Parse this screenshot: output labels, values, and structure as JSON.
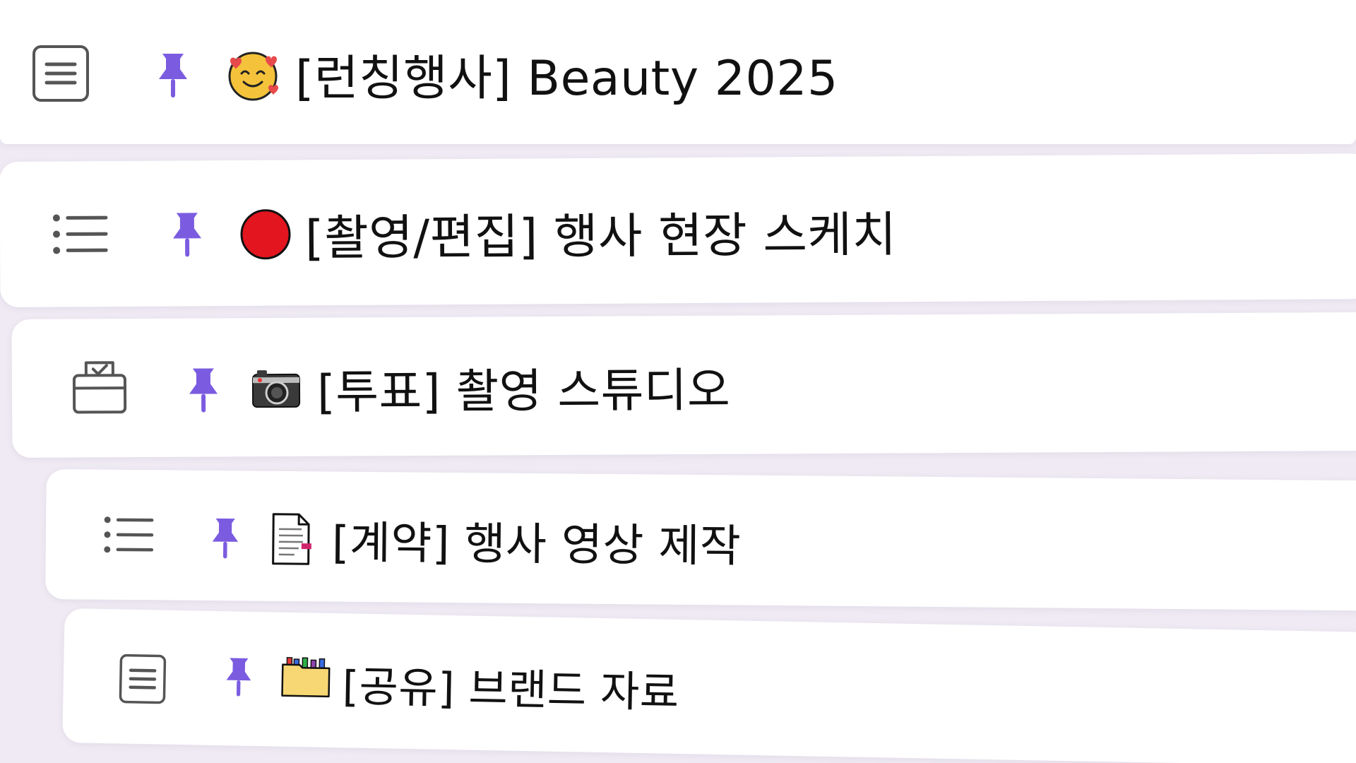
{
  "items": [
    {
      "type_icon": "document-lines-icon",
      "pin_icon": "pushpin-icon",
      "emoji": "smiling-face-with-hearts-icon",
      "title": "[런칭행사] Beauty 2025"
    },
    {
      "type_icon": "bulleted-list-icon",
      "pin_icon": "pushpin-icon",
      "emoji": "red-circle-icon",
      "title": "[촬영/편집] 행사 현장 스케치"
    },
    {
      "type_icon": "ballot-box-icon",
      "pin_icon": "pushpin-icon",
      "emoji": "camera-icon",
      "title": "[투표] 촬영 스튜디오"
    },
    {
      "type_icon": "bulleted-list-icon",
      "pin_icon": "pushpin-icon",
      "emoji": "page-with-curl-icon",
      "title": "[계약] 행사 영상 제작"
    },
    {
      "type_icon": "document-lines-icon",
      "pin_icon": "pushpin-icon",
      "emoji": "file-folder-icon",
      "title": "[공유] 브랜드 자료"
    }
  ],
  "colors": {
    "accent": "#7b5ce0",
    "background": "#efeaf3",
    "card": "#ffffff",
    "text": "#111111",
    "icon_gray": "#555555"
  }
}
